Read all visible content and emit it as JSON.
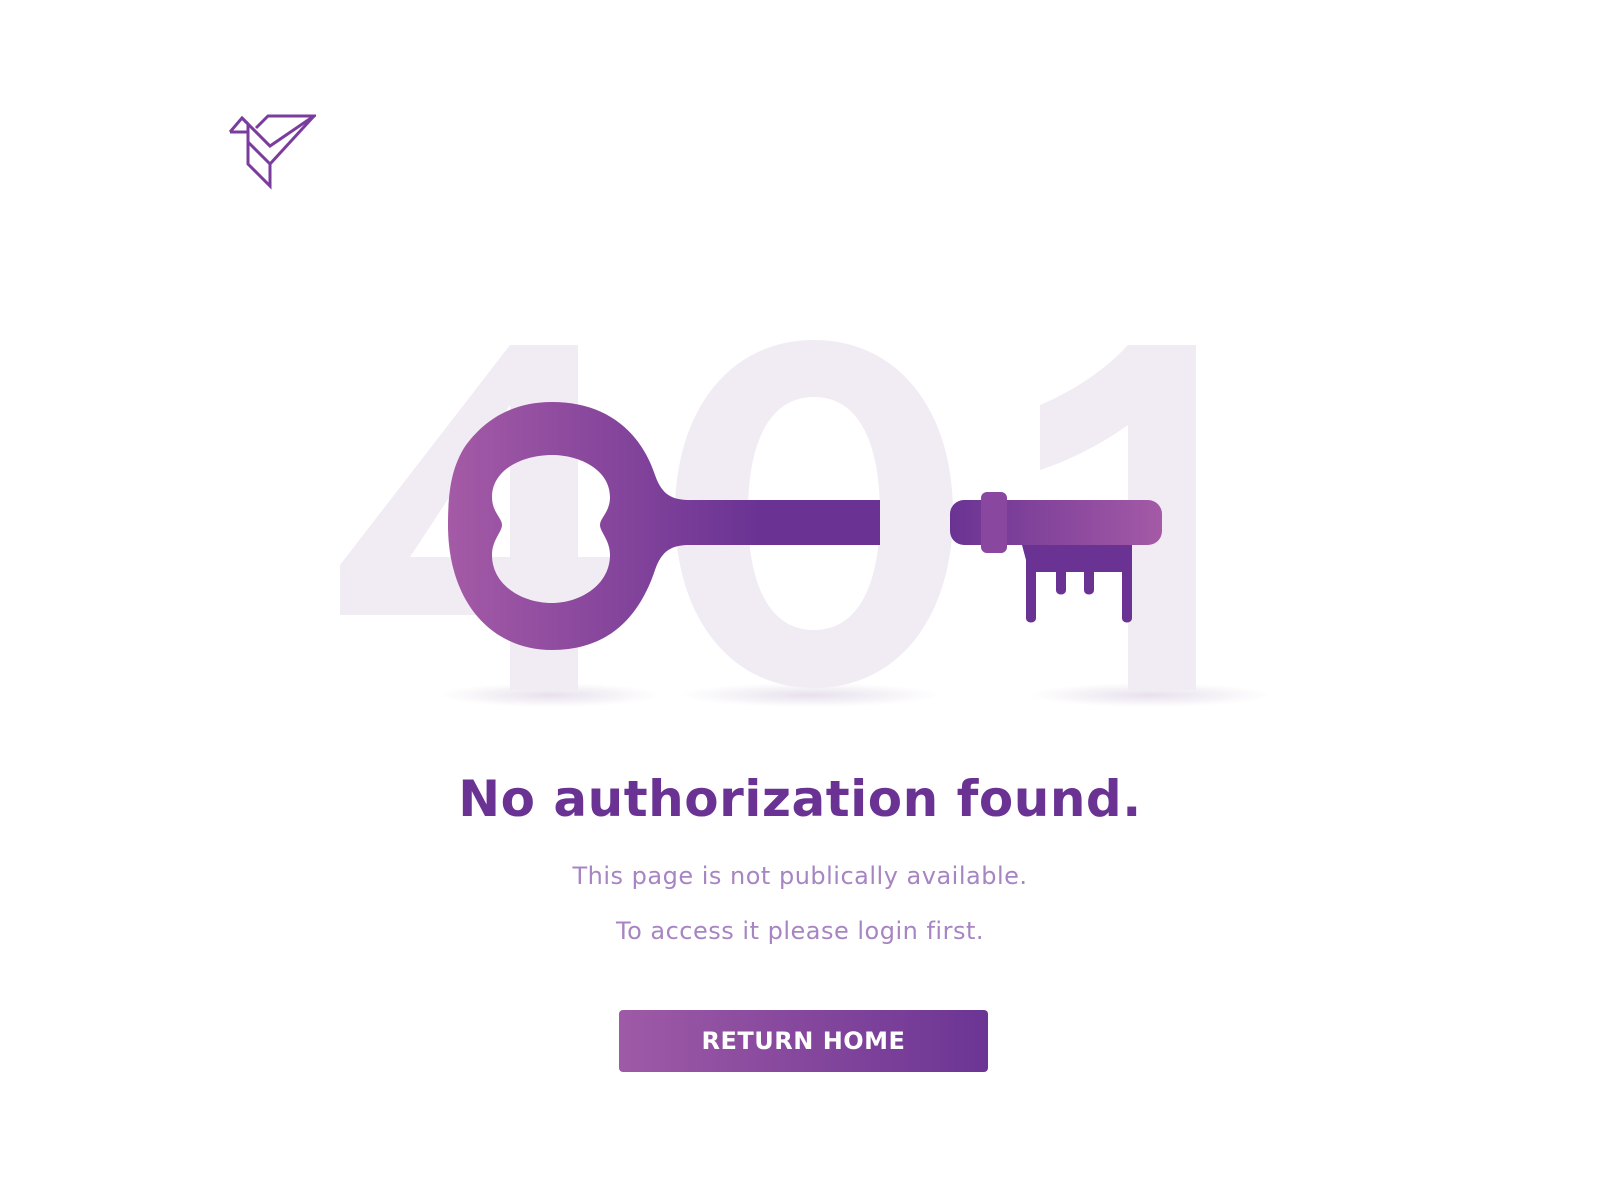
{
  "brand": {
    "logo_icon": "origami-bird-icon",
    "color": "#7a3d9e"
  },
  "hero": {
    "code_digits": [
      "4",
      "0",
      "1"
    ],
    "illustration_icon": "key-icon",
    "digit_color": "#f1ebf3",
    "key_gradient": [
      "#a45aa6",
      "#6a3393"
    ]
  },
  "message": {
    "headline": "No authorization found.",
    "line1": "This page is not publically available.",
    "line2": "To access it please login first."
  },
  "actions": {
    "return_home_label": "RETURN HOME"
  },
  "colors": {
    "headline": "#6a3393",
    "subtext": "#a785c2",
    "button_start": "#9e5aa6",
    "button_end": "#6c3594"
  }
}
